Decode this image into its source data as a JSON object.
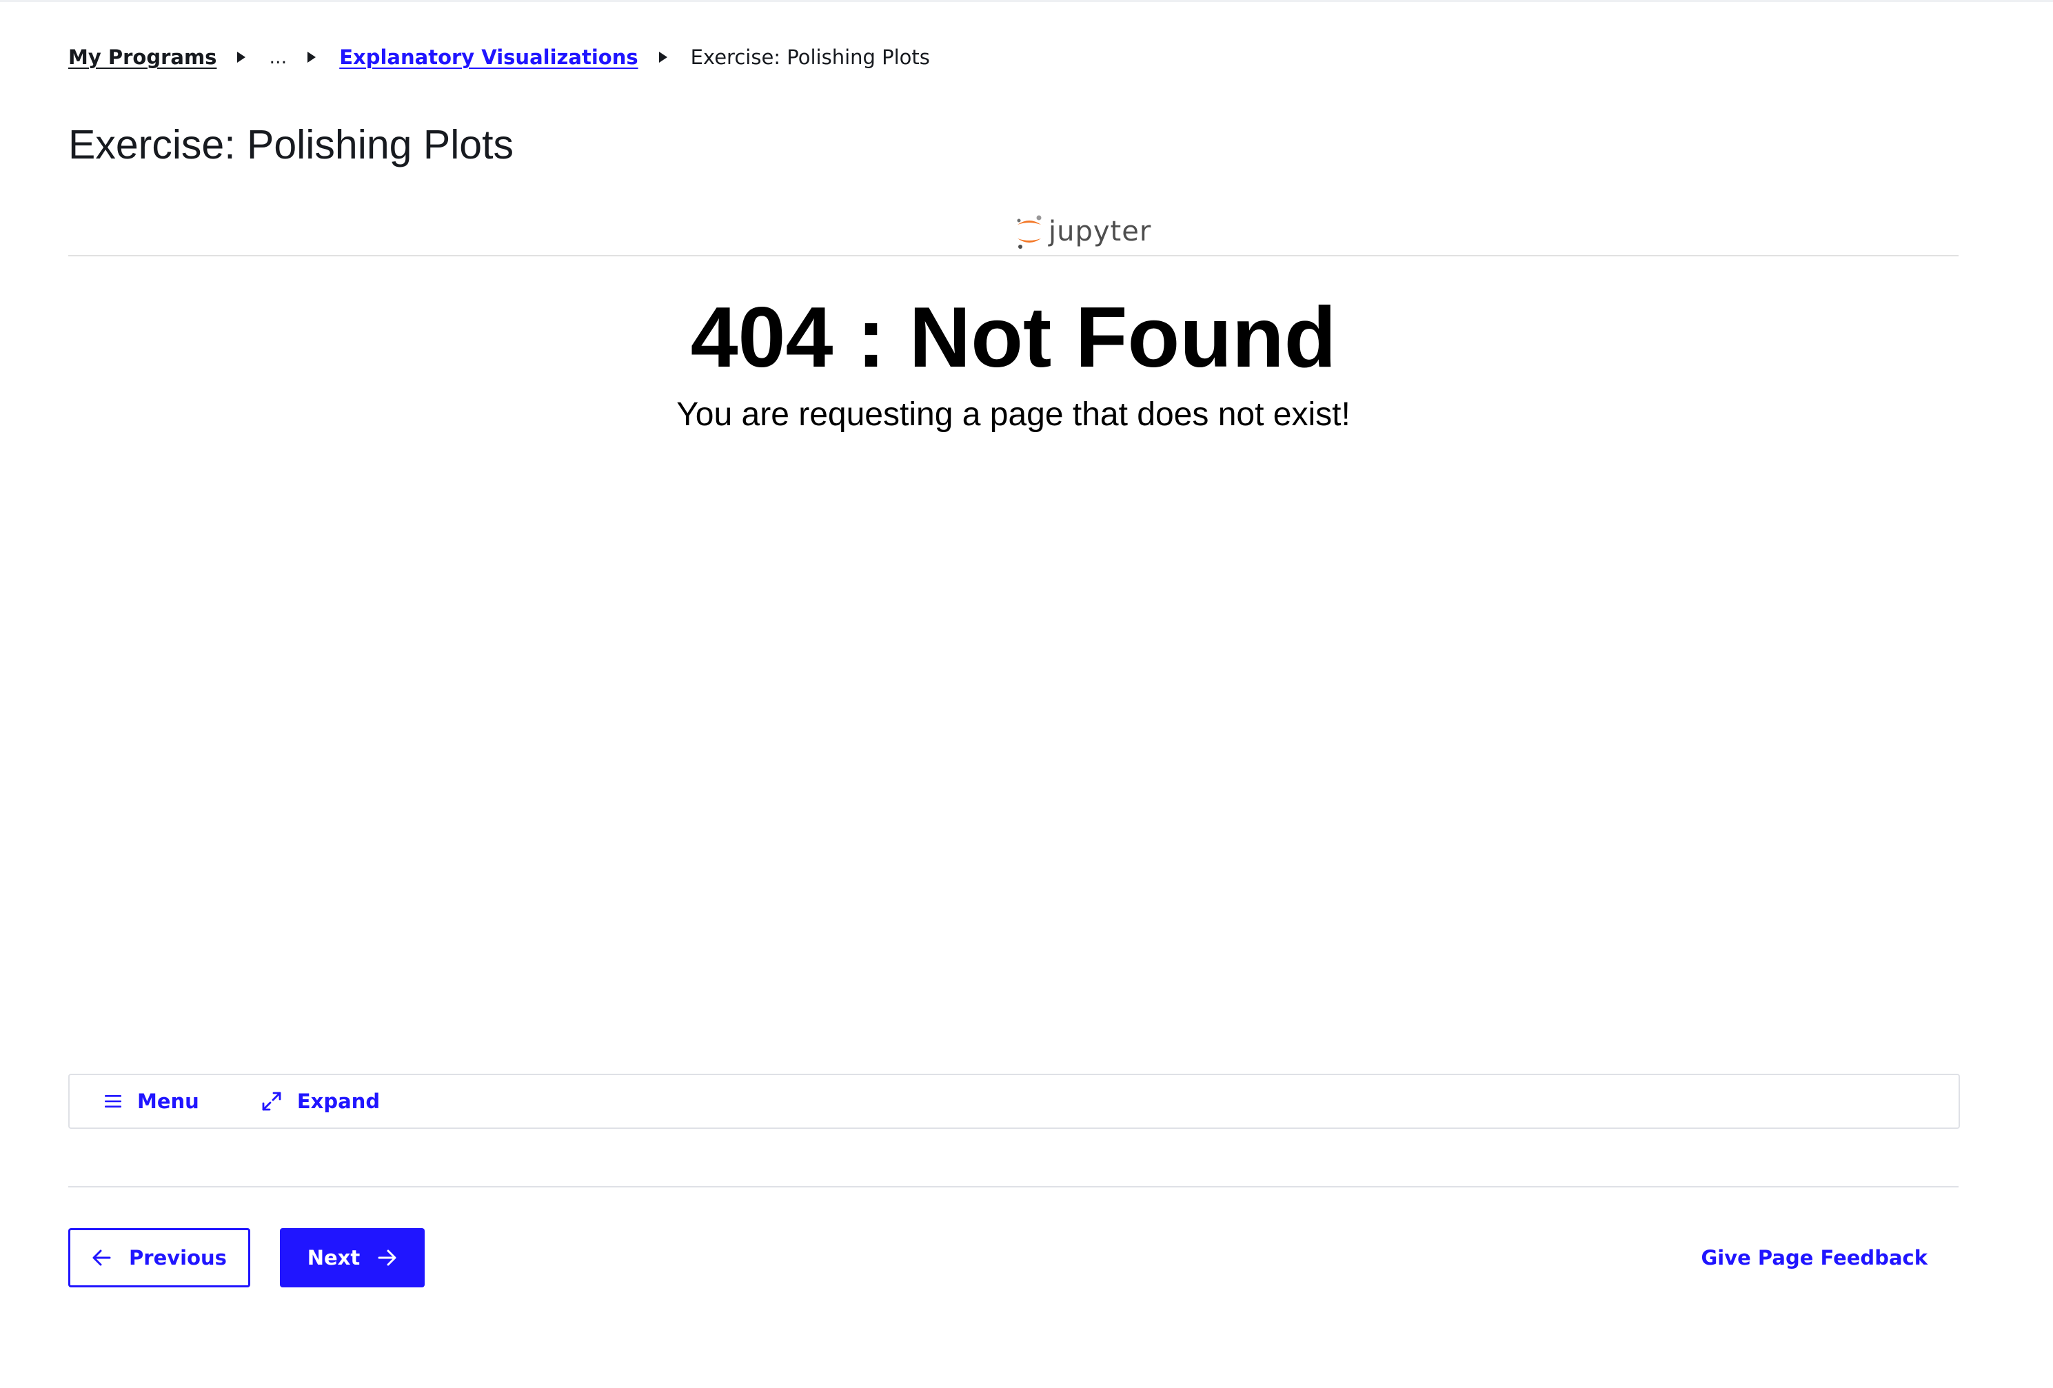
{
  "breadcrumb": {
    "home": "My Programs",
    "ellipsis": "...",
    "lesson": "Explanatory Visualizations",
    "current": "Exercise: Polishing Plots"
  },
  "page": {
    "title": "Exercise: Polishing Plots"
  },
  "jupyter": {
    "logo_text": "jupyter",
    "error_title": "404 : Not Found",
    "error_message": "You are requesting a page that does not exist!"
  },
  "toolbar": {
    "menu_label": "Menu",
    "menu_icon": "hamburger-icon",
    "expand_label": "Expand",
    "expand_icon": "expand-arrows-icon"
  },
  "footer": {
    "previous_label": "Previous",
    "next_label": "Next",
    "feedback_label": "Give Page Feedback"
  },
  "colors": {
    "accent": "#2015ff",
    "text": "#171a1f",
    "jupyter_orange": "#f37726",
    "border": "#dfe1e6"
  }
}
